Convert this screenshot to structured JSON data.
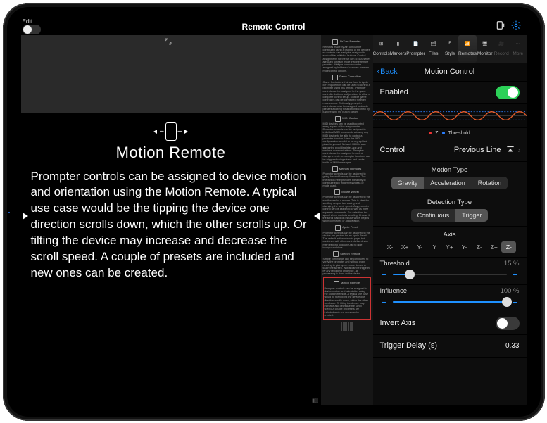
{
  "topbar": {
    "edit_label": "Edit",
    "title": "Remote Control"
  },
  "prompter": {
    "title": "Motion Remote",
    "body": "Prompter controls can be assigned to device motion and orientation using the Motion Remote. A typical use case would be the tipping the device one direction scrolls down, which the other scrolls up. Or tilting the device may increase and decrease the scroll speed. A couple of presets are included and new ones can be created."
  },
  "mini_sections": [
    {
      "title": "AirTurn Remotes",
      "text": "Remotes made by AirTurn can be configured using a graphic of the devices so controls can easily be assigned to each of the individua buttons. Control assignments for the AirTurn BT500 series are used for each mode that the remote provides. Multiple controls can be assigned by holders of remotes for even more control options."
    },
    {
      "title": "Game Controllers",
      "text": "Game Controllers that conform to Apple MFi requirement can be used to control a prompter using this remote. Prompter controls can be assigned to the game controller buttons and joysticks to allow a complete control setup. Multiple game controllers can be connected for even more control. Optionally, prompter controls can also be assigned to double presses allowing for additional control by just pressing the button harder."
    },
    {
      "title": "MIDI Control",
      "text": "MIDI devices can be used to control every aspect of the teleprompter. Prompter controls can be assigned to individual MIDI commands allowing any MIDI device to be able to control a prompter function. View the MIDI configuration as a list or as a graphical piano keyboard. Network MIDI is also supported providing inter-app and wireless communications. Prompter controls can be assigned to control change events so prompter functions can be triggered using sliders and knobs inside of MIDI messages."
    },
    {
      "title": "Memory Remotes",
      "text": "Prompter controls can be assigned to going-forward Memory Remotes. The interaction here provides the ability to configure each trigger regardless of mode used."
    },
    {
      "title": "Mouse Wheel",
      "text": "Prompter controls can be assigned to the scroll wheel of a mouse. This is ideal for scrolling scripts, text cueing and changing the scroll speed. Any prompter control can be assigned to well as three separate commands. For selection, the speed wheel controls scrolling. Choose if the scroll based on mouse wheel begins when connected or at activation."
    },
    {
      "title": "Apple Pencil",
      "text": "Prompter controls can be assigned to the double-tap gesture for an Apple Pencil. The default action when in-page, but combined with other controls the device may respond to double-tap to hide background docs."
    },
    {
      "title": "Speech Remote",
      "text": "Simple commands can be configured to verify the prompter and without even needing to pick up a remote device or touch the screen. Words can be triggered by any recording on device, all processing is done on the device."
    },
    {
      "title": "Motion Remote",
      "text": "Prompter controls can be assigned to device motion and orientation using the Motion Remote. A typical use case would be the tipping the device one direction scrolls down, which the other scrolls up. Or tilting the device may increase and decrease the scroll speed. A couple of presets are included and new ones can be created.",
      "selected": true
    }
  ],
  "panel": {
    "tabs": [
      "Controls",
      "Markers",
      "Prompter",
      "Files",
      "Style",
      "Remotes",
      "Monitor",
      "Record",
      "More"
    ],
    "selected_tab": 5,
    "back": "Back",
    "nav_title": "Motion Control",
    "enabled_label": "Enabled",
    "legend_z": "Z",
    "legend_threshold": "Threshold",
    "control_label": "Control",
    "control_value": "Previous Line",
    "motion_type": {
      "title": "Motion Type",
      "options": [
        "Gravity",
        "Acceleration",
        "Rotation"
      ],
      "selected": 0
    },
    "detection_type": {
      "title": "Detection Type",
      "options": [
        "Continuous",
        "Trigger"
      ],
      "selected": 1
    },
    "axis": {
      "title": "Axis",
      "options": [
        "X-",
        "X+",
        "Y-",
        "Y",
        "Y+",
        "Y-",
        "Z-",
        "Z+",
        "Z-"
      ],
      "selected": 8
    },
    "threshold": {
      "label": "Threshold",
      "value": "15 %",
      "percent": 15
    },
    "influence": {
      "label": "Influence",
      "value": "100 %",
      "percent": 100
    },
    "invert": {
      "label": "Invert Axis"
    },
    "trigger_delay": {
      "label": "Trigger Delay (s)",
      "value": "0.33"
    }
  }
}
